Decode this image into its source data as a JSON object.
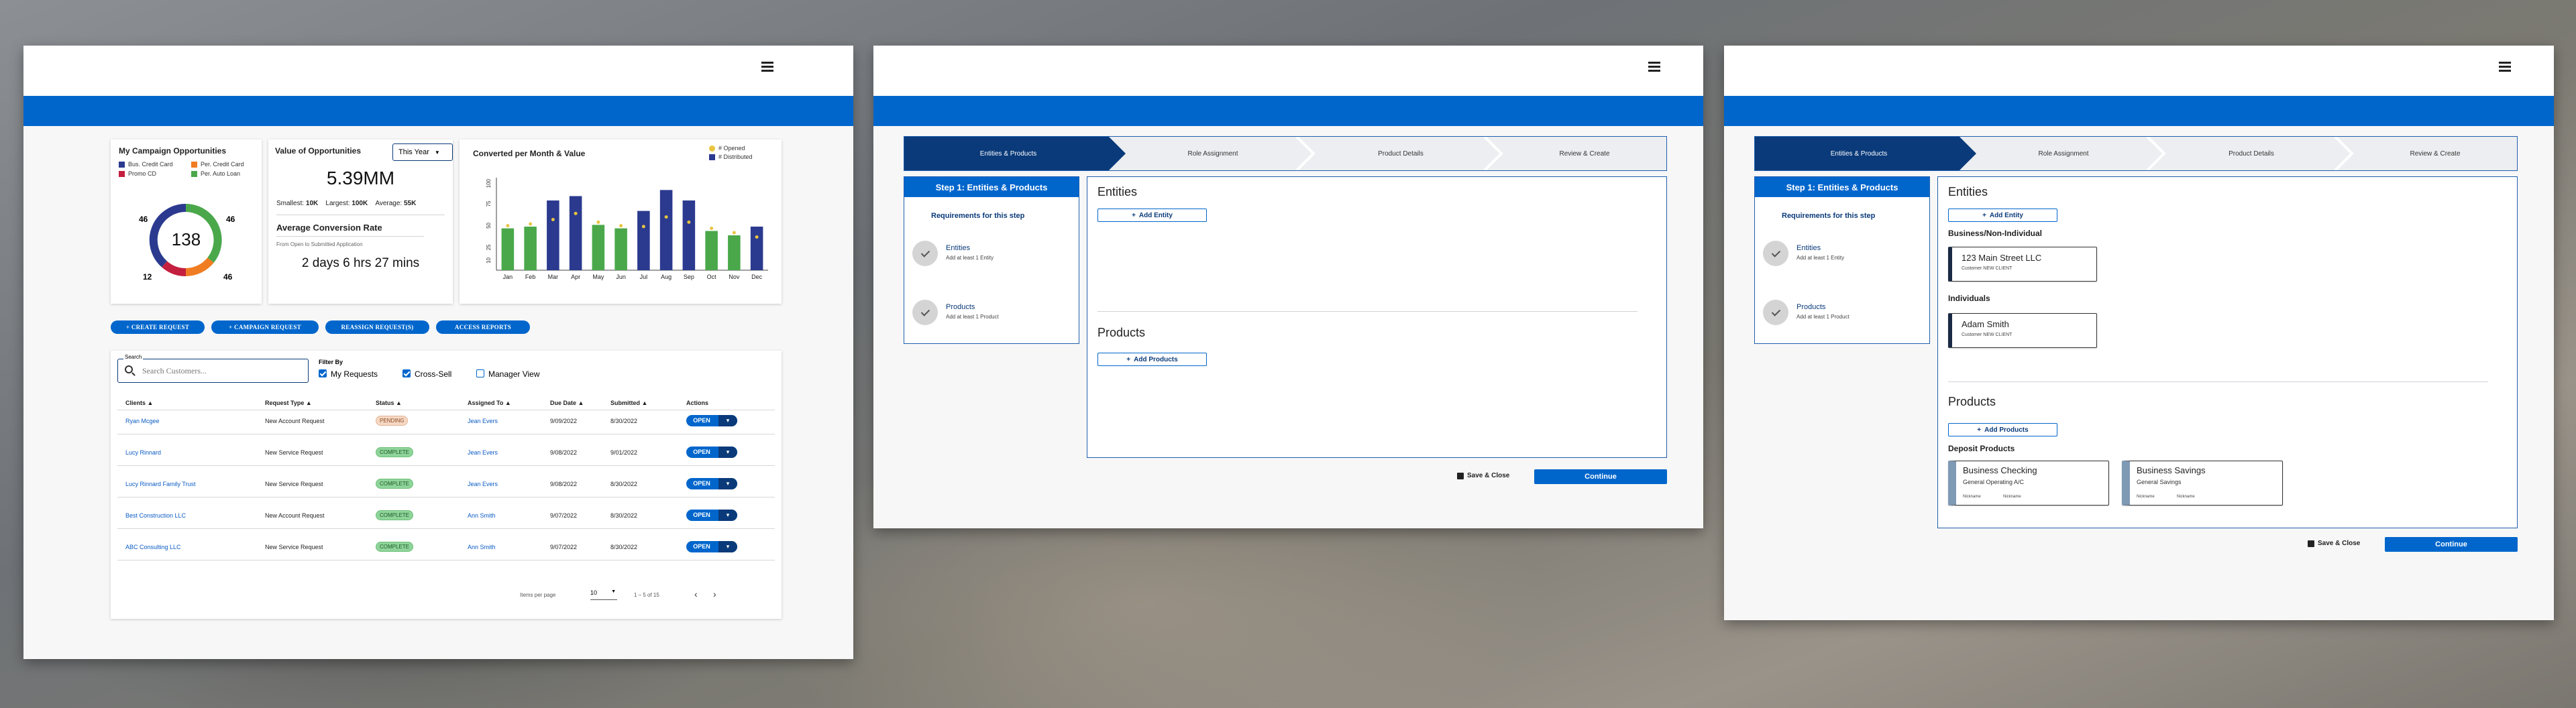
{
  "dashboard": {
    "campaign": {
      "title": "My Campaign Opportunities",
      "legend": [
        {
          "label": "Bus. Credit Card",
          "color": "#2b3a8f"
        },
        {
          "label": "Per. Credit Card",
          "color": "#f07d22"
        },
        {
          "label": "Promo CD",
          "color": "#c41f3e"
        },
        {
          "label": "Per. Auto Loan",
          "color": "#4aa84a"
        }
      ],
      "total": "138",
      "labels": {
        "top_left": "46",
        "top_right": "46",
        "bottom_left": "12",
        "bottom_right": "46"
      },
      "segments": [
        46,
        46,
        12,
        34
      ]
    },
    "value": {
      "title": "Value of Opportunities",
      "period": "This Year",
      "amount": "5.39MM",
      "smallest_label": "Smallest:",
      "smallest": "10K",
      "largest_label": "Largest:",
      "largest": "100K",
      "average_label": "Average:",
      "average": "55K",
      "conversion_title": "Average Conversion Rate",
      "conversion_sub": "From Open to Submitted Application",
      "conversion_value": "2 days 6 hrs 27 mins"
    },
    "chart": {
      "title": "Converted per Month & Value",
      "legend_opened": "# Opened",
      "legend_distributed": "# Distributed"
    },
    "actions": {
      "create_request": "CREATE REQUEST",
      "campaign_request": "CAMPAIGN REQUEST",
      "reassign": "REASSIGN REQUEST(S)",
      "access_reports": "ACCESS REPORTS"
    },
    "search": {
      "label": "Search",
      "placeholder": "Search Customers..."
    },
    "filter": {
      "label": "Filter By",
      "my_requests": "My Requests",
      "cross_sell": "Cross-Sell",
      "manager_view": "Manager View"
    },
    "table": {
      "headers": [
        "Clients",
        "Request Type",
        "Status",
        "Assigned To",
        "Due Date",
        "Submitted",
        "Actions"
      ],
      "rows": [
        {
          "client": "Ryan Mcgee",
          "type": "New Account Request",
          "status": "PENDING",
          "assigned": "Jean Evers",
          "due": "9/09/2022",
          "submitted": "8/30/2022",
          "action": "OPEN"
        },
        {
          "client": "Lucy Rinnard",
          "type": "New Service Request",
          "status": "COMPLETE",
          "assigned": "Jean Evers",
          "due": "9/08/2022",
          "submitted": "9/01/2022",
          "action": "OPEN"
        },
        {
          "client": "Lucy Rinnard Family Trust",
          "type": "New Service Request",
          "status": "COMPLETE",
          "assigned": "Jean Evers",
          "due": "9/08/2022",
          "submitted": "8/30/2022",
          "action": "OPEN"
        },
        {
          "client": "Best Construction LLC",
          "type": "New Account Request",
          "status": "COMPLETE",
          "assigned": "Ann Smith",
          "due": "9/07/2022",
          "submitted": "8/30/2022",
          "action": "OPEN"
        },
        {
          "client": "ABC Consulting LLC",
          "type": "New Service Request",
          "status": "COMPLETE",
          "assigned": "Ann Smith",
          "due": "9/07/2022",
          "submitted": "8/30/2022",
          "action": "OPEN"
        }
      ],
      "items_per_page_label": "Items per page",
      "items_per_page": "10",
      "range": "1 – 5 of 15"
    }
  },
  "chart_data": {
    "type": "bar",
    "title": "Converted per Month & Value",
    "categories": [
      "Jan",
      "Feb",
      "Mar",
      "Apr",
      "May",
      "Jun",
      "Jul",
      "Aug",
      "Sep",
      "Oct",
      "Nov",
      "Dec"
    ],
    "series": [
      {
        "name": "# Opened",
        "values": [
          48,
          50,
          55,
          62,
          52,
          48,
          47,
          58,
          52,
          45,
          40,
          35
        ]
      },
      {
        "name": "# Distributed",
        "values": [
          48,
          55,
          80,
          85,
          65,
          60,
          68,
          92,
          80,
          65,
          55,
          50
        ]
      }
    ],
    "bar_colors": [
      "#4aa84a",
      "#2b3a8f"
    ],
    "yticks": [
      10,
      25,
      50,
      75,
      100
    ],
    "ylim": [
      0,
      100
    ]
  },
  "wizard": {
    "steps": [
      "Entities & Products",
      "Role Assignment",
      "Product Details",
      "Review & Create"
    ],
    "side_title": "Step 1: Entities & Products",
    "req_title": "Requirements for this step",
    "req_entities": "Entities",
    "req_entities_sub": "Add at least 1 Entity",
    "req_products": "Products",
    "req_products_sub": "Add at least 1 Product",
    "entities_title": "Entities",
    "add_entity": "Add Entity",
    "products_title": "Products",
    "add_products": "Add Products",
    "save_close": "Save & Close",
    "continue": "Continue",
    "business_heading": "Business/Non-Individual",
    "business_name": "123 Main Street LLC",
    "business_sub": "Customer NEW CLIENT",
    "individuals_heading": "Individuals",
    "individual_name": "Adam Smith",
    "individual_sub": "Customer NEW CLIENT",
    "deposit_heading": "Deposit Products",
    "product1_name": "Business Checking",
    "product1_sub": "General Operating A/C",
    "product2_name": "Business Savings",
    "product2_sub": "General Savings",
    "meta_a": "Nickname",
    "meta_b": "Nickname"
  }
}
